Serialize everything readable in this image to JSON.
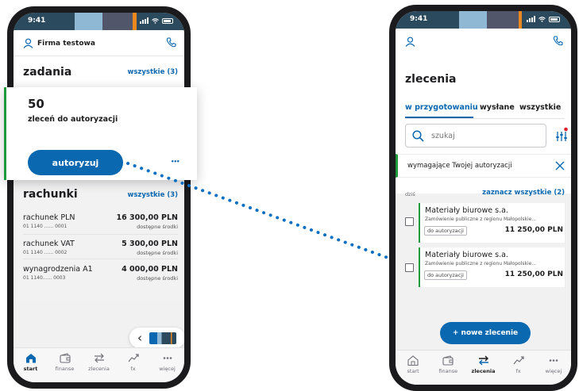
{
  "left_phone": {
    "status_time": "9:41",
    "company_name": "Firma testowa",
    "tasks": {
      "title": "zadania",
      "all_link": "wszystkie (3)"
    },
    "popup": {
      "count": "50",
      "subtitle": "zleceń do autoryzacji",
      "authorize_label": "autoryzuj",
      "more_label": "•••"
    },
    "accounts": {
      "title": "rachunki",
      "all_link": "wszystkie (3)",
      "items": [
        {
          "name": "rachunek PLN",
          "number": "01 1140 ...... 0001",
          "amount": "16 300,00 PLN",
          "note": "dostępne środki"
        },
        {
          "name": "rachunek VAT",
          "number": "01 1140 ...... 0002",
          "amount": "5 300,00 PLN",
          "note": "dostępne środki"
        },
        {
          "name": "wynagrodzenia A1",
          "number": "01 1140...... 0003",
          "amount": "4 000,00 PLN",
          "note": "dostępne środki"
        }
      ]
    },
    "carousel_back": "‹",
    "tabs": [
      {
        "label": "start",
        "icon": "home-icon",
        "active": true
      },
      {
        "label": "finanse",
        "icon": "wallet-icon",
        "active": false
      },
      {
        "label": "zlecenia",
        "icon": "transfer-icon",
        "active": false
      },
      {
        "label": "fx",
        "icon": "fx-icon",
        "active": false
      },
      {
        "label": "więcej",
        "icon": "more-icon",
        "active": false
      }
    ]
  },
  "right_phone": {
    "status_time": "9:41",
    "page_title": "zlecenia",
    "tabs": [
      "w przygotowaniu",
      "wysłane",
      "wszystkie"
    ],
    "search_placeholder": "szukaj",
    "filter_chip": "wymagające Twojej autoryzacji",
    "group_label": "dziś",
    "select_all": "zaznacz wszystkie (2)",
    "orders": [
      {
        "title": "Materiały biurowe s.a.",
        "desc": "Zamówienie publiczne z regionu Małopolskie...",
        "badge": "do autoryzacji",
        "amount": "11 250,00 PLN"
      },
      {
        "title": "Materiały biurowe s.a.",
        "desc": "Zamówienie publiczne z regionu Małopolskie...",
        "badge": "do autoryzacji",
        "amount": "11 250,00 PLN"
      }
    ],
    "new_order": "+ nowe zlecenie",
    "bottom_tabs": [
      {
        "label": "start",
        "icon": "home-icon",
        "active": false
      },
      {
        "label": "finanse",
        "icon": "wallet-icon",
        "active": false
      },
      {
        "label": "zlecenia",
        "icon": "transfer-icon",
        "active": true
      },
      {
        "label": "fx",
        "icon": "fx-icon",
        "active": false
      },
      {
        "label": "więcej",
        "icon": "more-icon",
        "active": false
      }
    ]
  },
  "colors": {
    "accent": "#0a68b0",
    "green": "#1e9a3c",
    "status_bar": "#2b4a5e"
  }
}
